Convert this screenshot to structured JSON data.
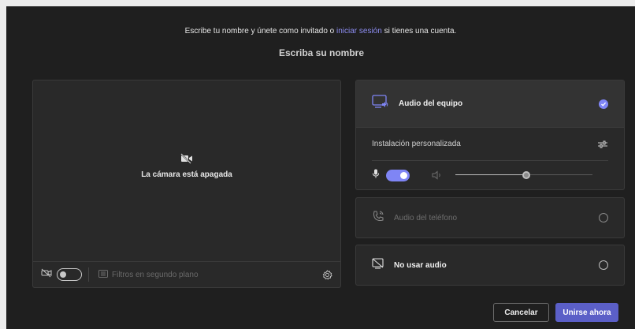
{
  "header": {
    "prompt_before": "Escribe tu nombre y únete como invitado o",
    "signin_link": "iniciar sesión",
    "prompt_after": "si tienes una cuenta."
  },
  "name_input": {
    "placeholder": "Escriba su nombre",
    "value": ""
  },
  "camera": {
    "status_text": "La cámara está apagada",
    "toggle_on": false,
    "background_filters_label": "Filtros en segundo plano"
  },
  "audio": {
    "options": [
      {
        "label": "Audio del equipo",
        "selected": true,
        "enabled": true,
        "icon": "computer-audio-icon"
      },
      {
        "label": "Audio del teléfono",
        "selected": false,
        "enabled": false,
        "icon": "phone-icon"
      },
      {
        "label": "No usar audio",
        "selected": false,
        "enabled": true,
        "icon": "no-audio-icon"
      }
    ],
    "custom_setup_label": "Instalación personalizada",
    "mic_toggle_on": true,
    "speaker_volume": 0.52
  },
  "buttons": {
    "cancel": "Cancelar",
    "join": "Unirse ahora"
  },
  "colors": {
    "background": "#1f1f1f",
    "panel": "#292929",
    "accent": "#7f85f5",
    "primary_button": "#5b5fc7"
  }
}
